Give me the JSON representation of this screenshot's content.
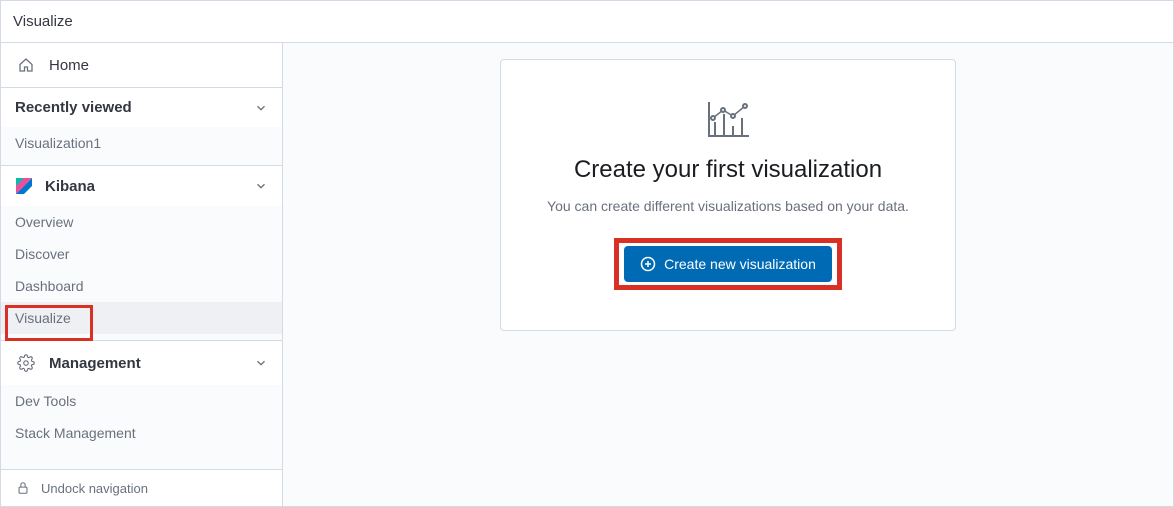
{
  "topbar": {
    "title": "Visualize"
  },
  "sidebar": {
    "home_label": "Home",
    "recently_viewed_label": "Recently viewed",
    "recent_items": [
      {
        "label": "Visualization1"
      }
    ],
    "kibana": {
      "label": "Kibana",
      "items": [
        {
          "label": "Overview",
          "active": false
        },
        {
          "label": "Discover",
          "active": false
        },
        {
          "label": "Dashboard",
          "active": false
        },
        {
          "label": "Visualize",
          "active": true
        }
      ]
    },
    "management": {
      "label": "Management",
      "items": [
        {
          "label": "Dev Tools"
        },
        {
          "label": "Stack Management"
        }
      ]
    },
    "undock_label": "Undock navigation"
  },
  "main": {
    "title": "Create your first visualization",
    "subtitle": "You can create different visualizations based on your data.",
    "button_label": "Create new visualization"
  }
}
